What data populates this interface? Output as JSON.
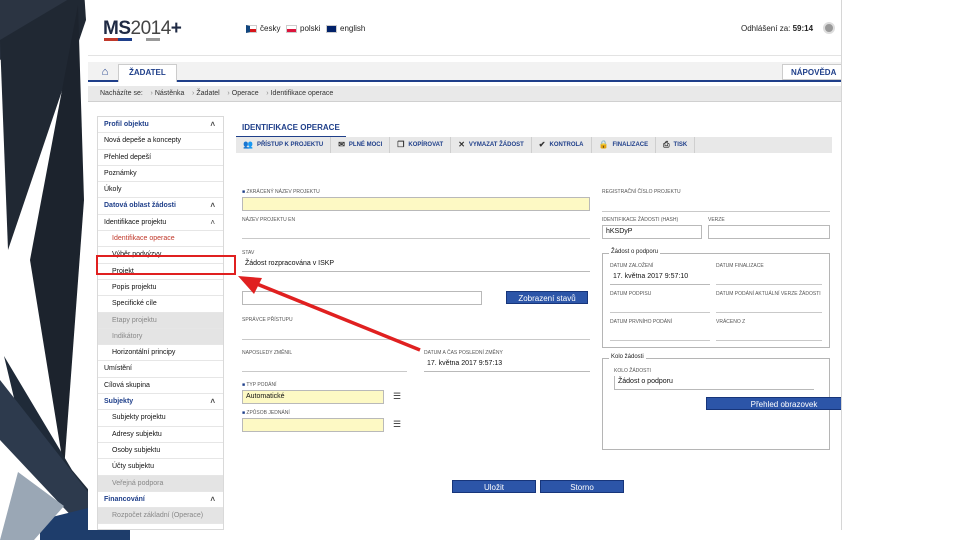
{
  "colors": {
    "brand_blue": "#1f3f8a",
    "button_blue": "#2c55a8",
    "annotation_red": "#e02020",
    "required_yellow": "#fdf9c4"
  },
  "header": {
    "logo": {
      "prefix": "MS",
      "suffix": "2014",
      "plus": "+"
    },
    "languages": [
      "česky",
      "polski",
      "english"
    ],
    "timer_label": "Odhlášení za:",
    "timer_value": "59:14",
    "reset_icon": "refresh-icon"
  },
  "nav": {
    "home_icon": "home-icon",
    "tab": "ŽADATEL",
    "help": "NÁPOVĚDA"
  },
  "breadcrumb": [
    "Nacházíte se:",
    "Nástěnka",
    "Žadatel",
    "Operace",
    "Identifikace operace"
  ],
  "sidebar": {
    "items": [
      {
        "label": "Profil objektu",
        "type": "head",
        "chevron": "˄"
      },
      {
        "label": "Nová depeše a koncepty",
        "type": "item"
      },
      {
        "label": "Přehled depeší",
        "type": "item"
      },
      {
        "label": "Poznámky",
        "type": "item"
      },
      {
        "label": "Úkoly",
        "type": "item"
      },
      {
        "label": "Datová oblast žádosti",
        "type": "head",
        "chevron": "˄"
      },
      {
        "label": "Identifikace projektu",
        "type": "item",
        "chevron": "˄"
      },
      {
        "label": "Identifikace operace",
        "type": "sub-active"
      },
      {
        "label": "Výběr podvýzvy",
        "type": "sub"
      },
      {
        "label": "Projekt",
        "type": "sub"
      },
      {
        "label": "Popis projektu",
        "type": "sub"
      },
      {
        "label": "Specifické cíle",
        "type": "sub"
      },
      {
        "label": "Etapy projektu",
        "type": "sub-disabled"
      },
      {
        "label": "Indikátory",
        "type": "sub-disabled"
      },
      {
        "label": "Horizontální principy",
        "type": "sub"
      },
      {
        "label": "Umístění",
        "type": "item"
      },
      {
        "label": "Cílová skupina",
        "type": "item"
      },
      {
        "label": "Subjekty",
        "type": "head",
        "chevron": "˄"
      },
      {
        "label": "Subjekty projektu",
        "type": "sub"
      },
      {
        "label": "Adresy subjektu",
        "type": "sub"
      },
      {
        "label": "Osoby subjektu",
        "type": "sub"
      },
      {
        "label": "Účty subjektu",
        "type": "sub"
      },
      {
        "label": "Veřejná podpora",
        "type": "sub-disabled"
      },
      {
        "label": "Financování",
        "type": "head",
        "chevron": "˄"
      },
      {
        "label": "Rozpočet základní (Operace)",
        "type": "sub-disabled"
      }
    ]
  },
  "form": {
    "tab": "IDENTIFIKACE OPERACE",
    "toolbar": [
      {
        "label": "PŘÍSTUP K PROJEKTU",
        "icon": "people-icon"
      },
      {
        "label": "PLNÉ MOCI",
        "icon": "mail-icon"
      },
      {
        "label": "KOPÍROVAT",
        "icon": "copy-icon"
      },
      {
        "label": "VYMAZAT ŽÁDOST",
        "icon": "close-icon"
      },
      {
        "label": "KONTROLA",
        "icon": "check-icon"
      },
      {
        "label": "FINALIZACE",
        "icon": "lock-icon"
      },
      {
        "label": "TISK",
        "icon": "print-icon"
      }
    ],
    "labels": {
      "project_short_name": "ZKRÁCENÝ NÁZEV PROJEKTU",
      "project_name_en": "NÁZEV PROJEKTU EN",
      "reg_number": "REGISTRAČNÍ ČÍSLO PROJEKTU",
      "request_id": "IDENTIFIKACE ŽÁDOSTI (HASH)",
      "version": "VERZE",
      "status": "STAV",
      "status_history_btn": "Zobrazení stavů",
      "access_admin": "SPRÁVCE PŘÍSTUPU",
      "last_changed_by": "NAPOSLEDY ZMĚNIL",
      "last_change_datetime": "DATUM A ČAS POSLEDNÍ ZMĚNY",
      "submission_type": "TYP PODÁNÍ",
      "signing_method": "ZPŮSOB JEDNÁNÍ"
    },
    "values": {
      "request_id": "hKSDyP",
      "status": "Žádost rozpracována v ISKP",
      "last_change_datetime": "17. května 2017 9:57:13",
      "submission_type": "Automatické"
    },
    "support_group": {
      "title": "Žádost o podporu",
      "labels": {
        "created": "DATUM ZALOŽENÍ",
        "finalized": "DATUM FINALIZACE",
        "signed": "DATUM PODPISU",
        "submitted_current": "DATUM PODÁNÍ AKTUÁLNÍ VERZE ŽÁDOSTI",
        "first_submitted": "DATUM PRVNÍHO PODÁNÍ",
        "returned": "VRÁCENO Z"
      },
      "values": {
        "created": "17. května 2017 9:57:10"
      }
    },
    "role_group": {
      "title": "Kolo žádosti",
      "label": "KOLO ŽÁDOSTI",
      "value": "Žádost o podporu",
      "button": "Přehled obrazovek"
    },
    "save_button": "Uložit",
    "cancel_button": "Storno"
  }
}
